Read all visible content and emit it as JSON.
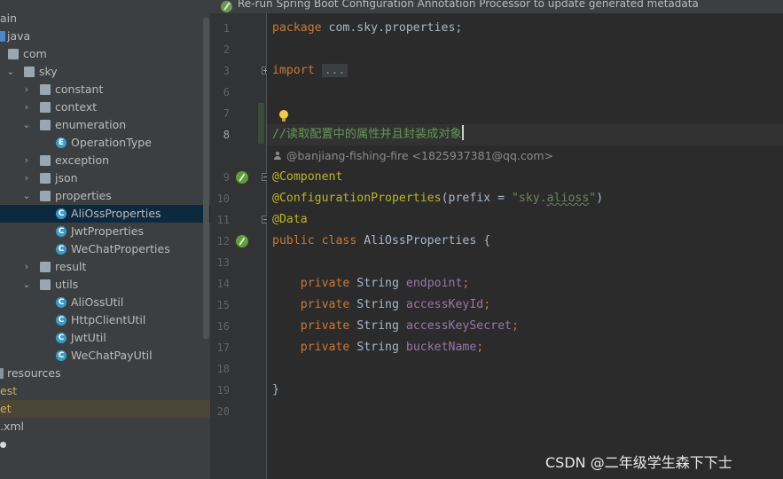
{
  "notification": {
    "text": "Re-run Spring Boot Configuration Annotation Processor to update generated metadata"
  },
  "tree": {
    "items": [
      {
        "label": "ain"
      },
      {
        "label": "java"
      },
      {
        "label": "com"
      },
      {
        "label": "sky"
      },
      {
        "label": "constant"
      },
      {
        "label": "context"
      },
      {
        "label": "enumeration"
      },
      {
        "label": "OperationType",
        "icon": "E"
      },
      {
        "label": "exception"
      },
      {
        "label": "json"
      },
      {
        "label": "properties"
      },
      {
        "label": "AliOssProperties",
        "icon": "C"
      },
      {
        "label": "JwtProperties",
        "icon": "C"
      },
      {
        "label": "WeChatProperties",
        "icon": "C"
      },
      {
        "label": "result"
      },
      {
        "label": "utils"
      },
      {
        "label": "AliOssUtil",
        "icon": "C"
      },
      {
        "label": "HttpClientUtil",
        "icon": "C"
      },
      {
        "label": "JwtUtil",
        "icon": "C"
      },
      {
        "label": "WeChatPayUtil",
        "icon": "C"
      },
      {
        "label": "resources"
      },
      {
        "label": "est"
      },
      {
        "label": "et"
      },
      {
        "label": ".xml"
      }
    ]
  },
  "editor": {
    "line_numbers": [
      "1",
      "2",
      "3",
      "6",
      "7",
      "8",
      "9",
      "10",
      "11",
      "12",
      "13",
      "14",
      "15",
      "16",
      "17",
      "18",
      "19",
      "20"
    ],
    "lines": {
      "l1_kw": "package",
      "l1_rest": " com.sky.properties;",
      "l3_kw": "import",
      "l3_fold": "...",
      "l8_comment": "//读取配置中的属性并且封装成对象",
      "author": "@banjiang-fishing-fire <1825937381@qq.com>",
      "l9_ann": "@Component",
      "l10_ann": "@ConfigurationProperties",
      "l10_paren": "(prefix = ",
      "l10_str_open": "\"sky.",
      "l10_str_word": "alioss",
      "l10_str_close": "\"",
      "l10_end": ")",
      "l11_ann": "@Data",
      "l12_kw": "public class",
      "l12_rest": " AliOssProperties {",
      "private_kw": "private",
      "type": "String",
      "f1": "endpoint",
      "f2": "accessKeyId",
      "f3": "accessKeySecret",
      "f4": "bucketName",
      "semi": ";",
      "close_brace": "}"
    }
  },
  "watermark": "CSDN @二年级学生森下下士"
}
